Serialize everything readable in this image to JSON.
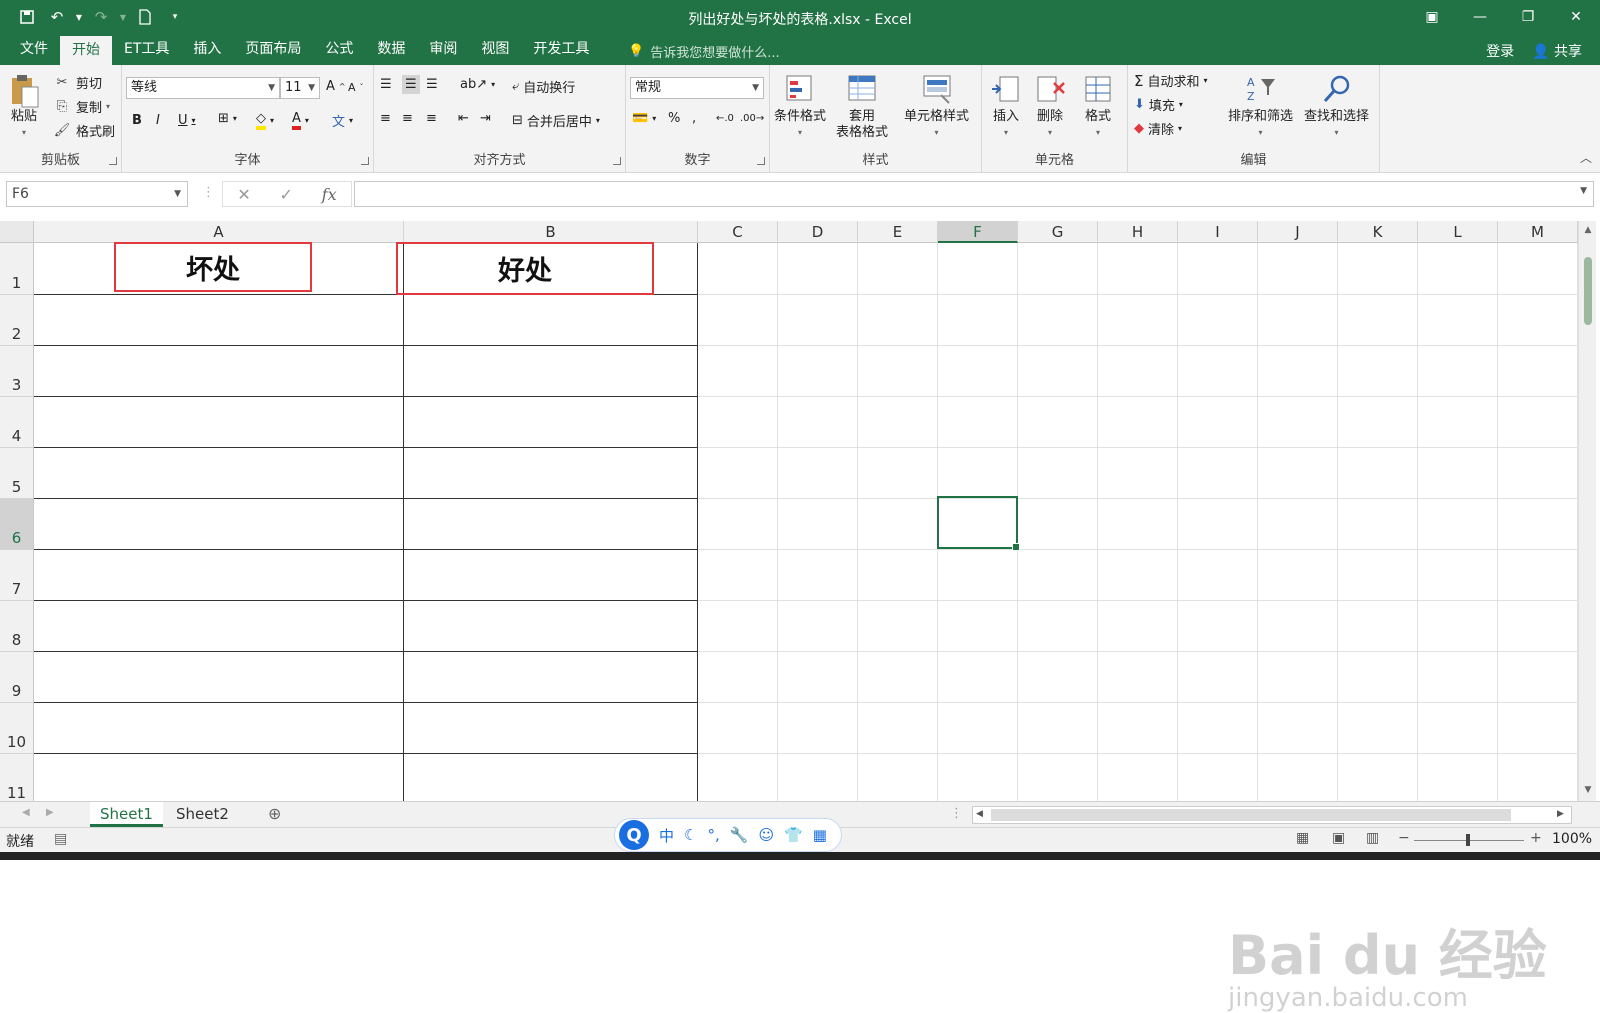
{
  "window": {
    "title": "列出好处与坏处的表格.xlsx - Excel"
  },
  "menu": {
    "tabs": [
      "文件",
      "开始",
      "ET工具",
      "插入",
      "页面布局",
      "公式",
      "数据",
      "审阅",
      "视图",
      "开发工具"
    ],
    "tell_me": "告诉我您想要做什么...",
    "login": "登录",
    "share": "共享"
  },
  "ribbon": {
    "clipboard": {
      "label": "剪贴板",
      "paste": "粘贴",
      "cut": "剪切",
      "copy": "复制",
      "format_painter": "格式刷"
    },
    "font": {
      "label": "字体",
      "font_name": "等线",
      "font_size": "11"
    },
    "alignment": {
      "label": "对齐方式",
      "wrap": "自动换行",
      "merge": "合并后居中"
    },
    "number": {
      "label": "数字",
      "format": "常规"
    },
    "styles": {
      "label": "样式",
      "conditional": "条件格式",
      "table_line1": "套用",
      "table_line2": "表格格式",
      "cell_styles": "单元格样式"
    },
    "cells": {
      "label": "单元格",
      "insert": "插入",
      "delete": "删除",
      "format": "格式"
    },
    "editing": {
      "label": "编辑",
      "autosum": "自动求和",
      "fill": "填充",
      "clear": "清除",
      "sort": "排序和筛选",
      "find": "查找和选择"
    }
  },
  "formula_bar": {
    "name_box": "F6",
    "fx": "fx",
    "value": ""
  },
  "sheet": {
    "columns": [
      "A",
      "B",
      "C",
      "D",
      "E",
      "F",
      "G",
      "H",
      "I",
      "J",
      "K",
      "L",
      "M"
    ],
    "rows": [
      "1",
      "2",
      "3",
      "4",
      "5",
      "6",
      "7",
      "8",
      "9",
      "10",
      "11"
    ],
    "selected_cell": "F6",
    "cells": {
      "A1": "坏处",
      "B1": "好处"
    }
  },
  "sheet_tabs": [
    "Sheet1",
    "Sheet2"
  ],
  "status": {
    "ready": "就绪",
    "zoom": "100%"
  },
  "ime": {
    "lang": "中"
  },
  "watermark": {
    "main": "Bai du 经验",
    "sub": "jingyan.baidu.com"
  },
  "colors": {
    "brand": "#217346",
    "highlight_border": "#e0393e"
  }
}
